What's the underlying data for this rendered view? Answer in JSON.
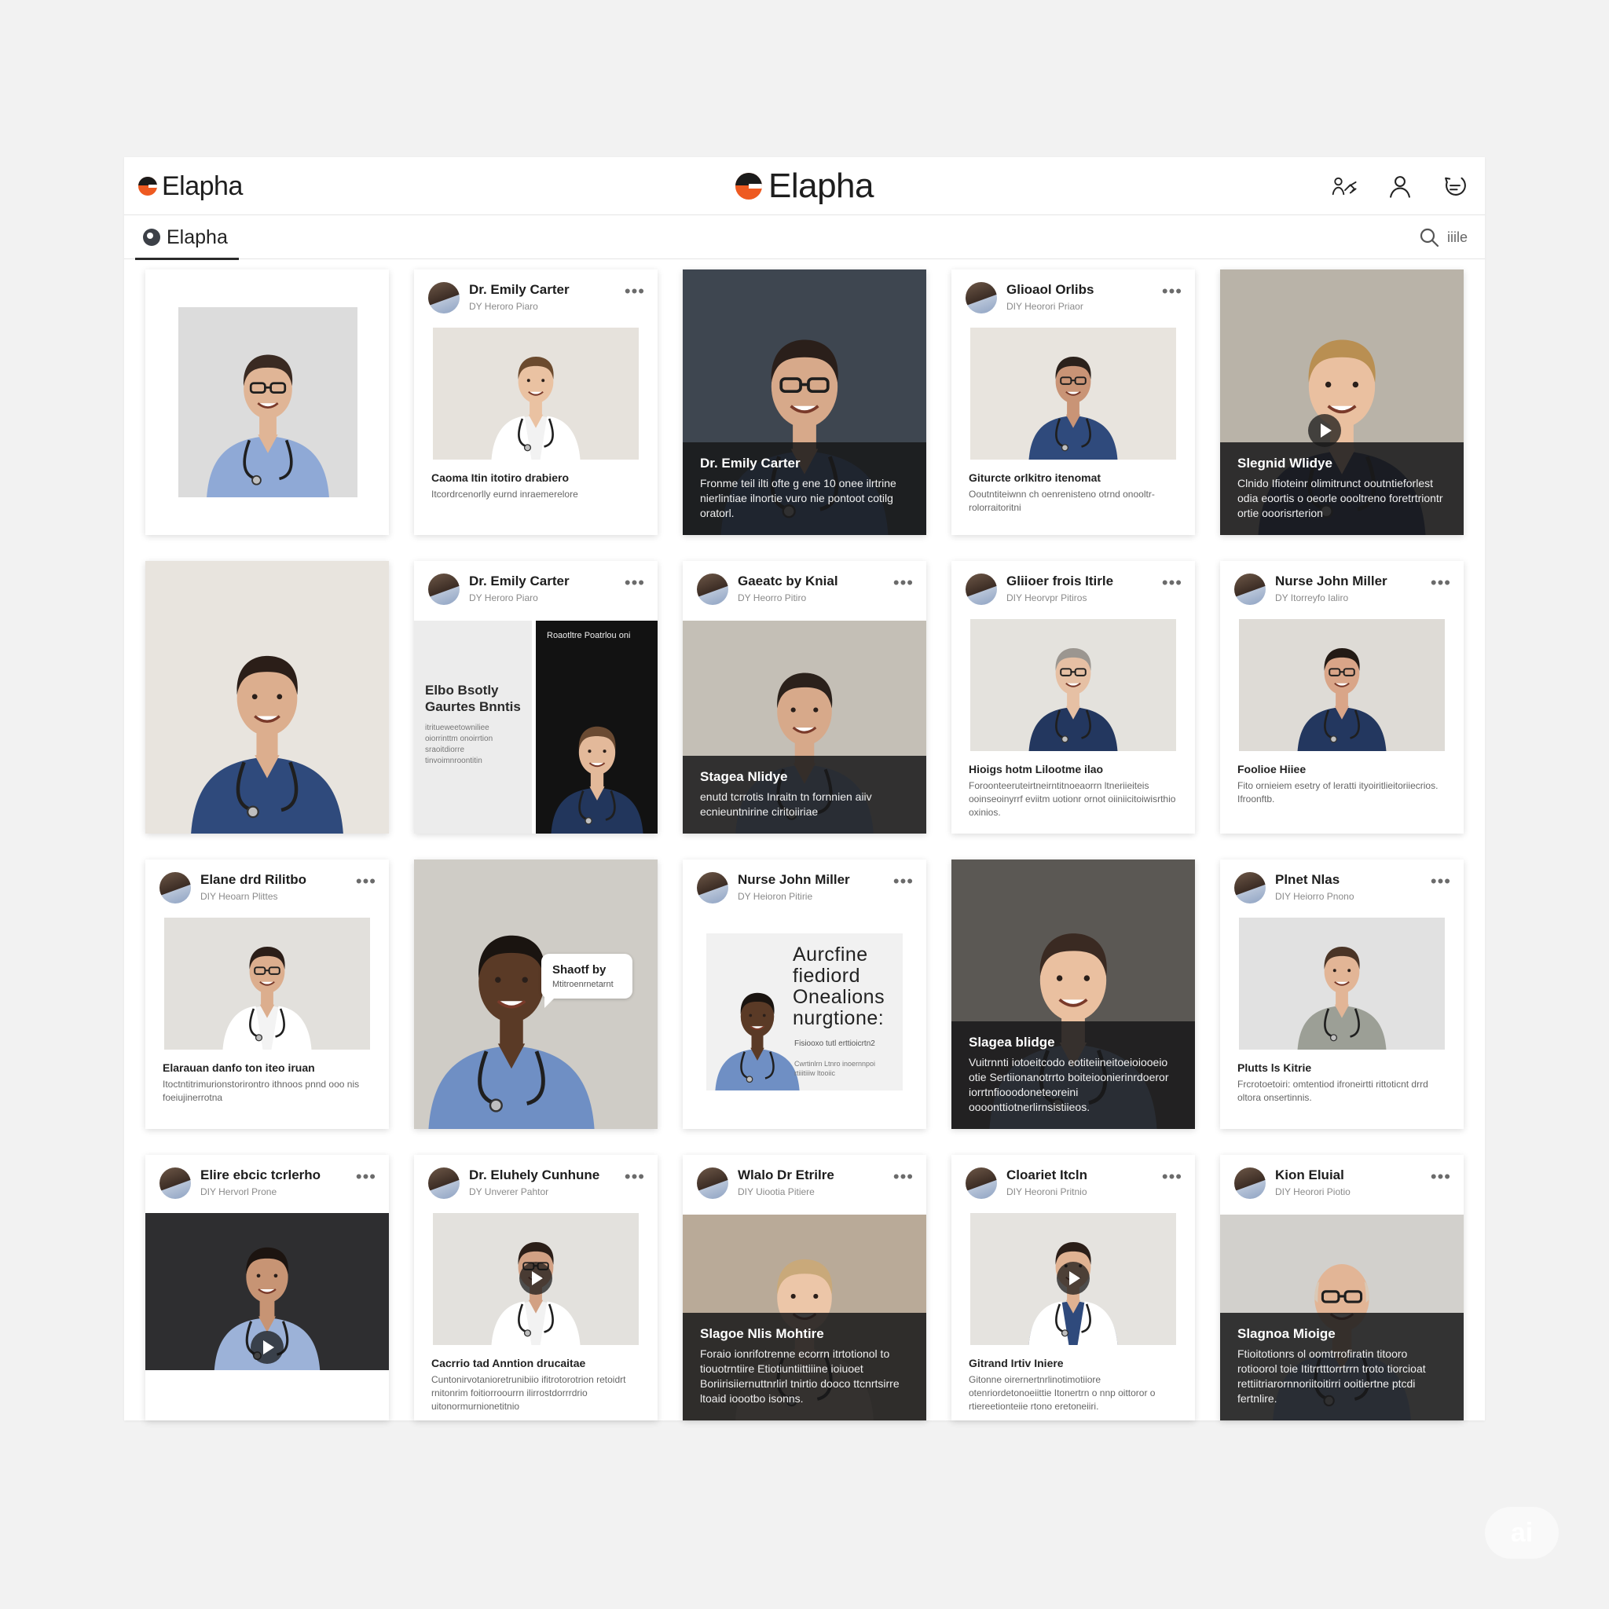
{
  "header": {
    "brand_left": "Elapha",
    "brand_center": "Elapha",
    "icons": [
      "connections-icon",
      "profile-icon",
      "messages-icon"
    ]
  },
  "subnav": {
    "tab_label": "Elapha",
    "search_label": "iiile"
  },
  "colors": {
    "brand_orange": "#ee5a21",
    "brand_dark": "#1b1b1b",
    "overlay": "#18181a",
    "scrub_light": "#8fa9d6",
    "scrub_navy": "#2f4a7c"
  },
  "posts": [
    {
      "id": 1,
      "layout": "portrait",
      "bg": "#dcdcdc",
      "scrubs": "#8fa9d6",
      "skin": "#e0b596",
      "hair": "#3a2a22",
      "glasses": true,
      "coat": false
    },
    {
      "id": 2,
      "layout": "post",
      "author": "Dr. Emily Carter",
      "meta": "DY Heroro Piaro",
      "photo_bg": "#e6e2dc",
      "scrubs": "#f2f2f2",
      "skin": "#eac2a2",
      "hair": "#6b4a2e",
      "coat": true,
      "caption_title": "Caoma Itin itotiro drabiero",
      "caption_body": "Itcordrcenorlly eurnd inraemerelore"
    },
    {
      "id": 3,
      "layout": "overlay",
      "bg": "#3e4650",
      "scrubs": "#4a6fb3",
      "skin": "#d7a98a",
      "hair": "#2a1f1a",
      "glasses": true,
      "overlay_title": "Dr. Emily Carter",
      "overlay_body": "Fronme teil ilti ofte g ene 10 onee ilrtrine nierlintiae ilnortie vuro nie pontoot cotilg oratorl."
    },
    {
      "id": 4,
      "layout": "post",
      "author": "Glioaol Orlibs",
      "meta": "DIY Heorori Priaor",
      "photo_bg": "#e8e4de",
      "scrubs": "#2f4a7c",
      "skin": "#c99476",
      "hair": "#2b211b",
      "glasses": true,
      "caption_title": "Giturcte orlkitro itenomat",
      "caption_body": "Ooutntiteiwnn ch oenrenisteno otrnd onooltr-rolorraitoritni"
    },
    {
      "id": 5,
      "layout": "overlay",
      "bg": "#b9b3a8",
      "scrubs": "#23375f",
      "skin": "#eac0a0",
      "hair": "#b98f52",
      "play": true,
      "overlay_title": "Slegnid Wlidye",
      "overlay_body": "Clnido Ifioteinr olimitrunct ooutntieforlest odia eoortis o oeorle oooltreno foretrtriontr ortie ooorisrterion"
    },
    {
      "id": 6,
      "layout": "portrait-full",
      "bg": "#e8e4de",
      "scrubs": "#2f4a7c",
      "skin": "#dcae8e",
      "hair": "#2b1e18",
      "arms": true
    },
    {
      "id": 7,
      "layout": "split",
      "author": "Dr. Emily Carter",
      "meta": "DY Heroro Piaro",
      "left_title": "Elbo Bsotly Gaurtes Bnntis",
      "left_body": "itritueweetowniliee oiorrinttm onoirrtion sraoitdiorre tinvoimnroontitin",
      "right_label": "Roaotltre Poatrlou oni",
      "scrubs": "#22365c",
      "skin": "#e3b99a",
      "hair": "#6a4a32"
    },
    {
      "id": 8,
      "layout": "post-overlay",
      "author": "Gaeatc by Knial",
      "meta": "DY Heorro Pitiro",
      "photo_bg": "#c4bfb6",
      "scrubs": "#8fa9d6",
      "skin": "#d7a98a",
      "hair": "#2b211b",
      "overlay_title": "Stagea Nlidye",
      "overlay_body": "enutd tcrrotis Inraitn tn fornnien aiiv ecnieuntnirine ciritoiiriae"
    },
    {
      "id": 9,
      "layout": "post",
      "author": "Gliioer frois Itirle",
      "meta": "DIY Heorvpr Pitiros",
      "photo_bg": "#e4e2dd",
      "scrubs": "#23375f",
      "skin": "#e6c0a4",
      "hair": "#9b9690",
      "glasses": true,
      "caption_title": "Hioigs hotm Lilootme ilao",
      "caption_body": "Foroonteeruteirtneirntitnoeaorrn ltneriieiteis ooinseoinyrrf eviitm uotionr ornot oiiniicitoiwisrthio oxinios."
    },
    {
      "id": 10,
      "layout": "post",
      "author": "Nurse John Miller",
      "meta": "DY Itorreyfo Ialiro",
      "photo_bg": "#dedbd6",
      "scrubs": "#23375f",
      "skin": "#d9a588",
      "hair": "#231a15",
      "glasses": true,
      "caption_title": "Foolioe Hiiee",
      "caption_body": "Fito ornieiem esetry of leratti ityoiritlieitoriiecrios. Ifroonftb."
    },
    {
      "id": 11,
      "layout": "post",
      "author": "Elane drd Rilitbo",
      "meta": "DIY Heoarn Plittes",
      "photo_bg": "#e2e0dc",
      "scrubs": "#f3f3f3",
      "skin": "#dcae8e",
      "hair": "#2b1e18",
      "glasses": true,
      "coat": true,
      "caption_title": "Elarauan danfo ton iteo iruan",
      "caption_body": "Itoctntitrimurionstorirontro ithnoos pnnd ooo nis foeiujinerrotna"
    },
    {
      "id": 12,
      "layout": "bubble",
      "bg": "#cfccc6",
      "scrubs": "#6f8fc4",
      "skin": "#5a3a26",
      "hair": "#1a1410",
      "bubble_title": "Shaotf by",
      "bubble_body": "Mtitroenrnetarnt"
    },
    {
      "id": 13,
      "layout": "ad",
      "author": "Nurse John Miller",
      "meta": "DY Heioron Pitirie",
      "ad_title": "Aurcfine fiediord Onealions nurgtione:",
      "ad_body": "Fisiooxo tutl erttioicrtn2",
      "ad_sub": "Cwrtinlrn Ltnro inoernnpoi rtiiitiiiw ltooiic",
      "scrubs": "#6f8fc4",
      "skin": "#5a3a26",
      "hair": "#1a1410"
    },
    {
      "id": 14,
      "layout": "overlay",
      "bg": "#5b5854",
      "scrubs": "#8fa9d6",
      "skin": "#eac0a0",
      "hair": "#3a2a22",
      "overlay_title": "Slagea blidge",
      "overlay_body": "Vuitrnnti iotoeitcodo eotiteiineitoeioiooeio otie Sertiionanotrrto boiteioonierinrdoeror iorrtnfiooodoneteoreini oooonttiotnerlirnsistiieos."
    },
    {
      "id": 15,
      "layout": "post",
      "author": "Plnet Nlas",
      "meta": "DIY Heiorro Pnono",
      "photo_bg": "#e1e1e1",
      "scrubs": "#9c9f96",
      "skin": "#e2b596",
      "hair": "#4a3426",
      "caption_title": "Plutts ls Kitrie",
      "caption_body": "Frcrotoetoiri: omtentiod ifroneirtti rittoticnt drrd oltora onsertinnis."
    },
    {
      "id": 16,
      "layout": "post-dark",
      "author": "Elire ebcic tcrlerho",
      "meta": "DIY Hervorl Prone",
      "photo_bg": "#2e2e30",
      "scrubs": "#9cb2d8",
      "skin": "#c79474",
      "hair": "#1c1410",
      "play": true
    },
    {
      "id": 17,
      "layout": "post",
      "author": "Dr. Eluhely Cunhune",
      "meta": "DY Unverer Pahtor",
      "photo_bg": "#e3e1dd",
      "scrubs": "#f2f2f2",
      "skin": "#d2a184",
      "hair": "#2b1e18",
      "glasses": true,
      "coat": true,
      "play": true,
      "caption_title": "Cacrrio tad Anntion drucaitae",
      "caption_body": "Cuntonirvotanioretrunibiio ifitrotorotrion retoidrt rnitonrim foitiorroourrn ilirrostdorrrdrio uitonormurnionetitnio"
    },
    {
      "id": 18,
      "layout": "post-overlay",
      "author": "Wlalo Dr Etrilre",
      "meta": "DIY Uiootia Pitiere",
      "photo_bg": "#b9aa98",
      "scrubs": "#d8c6b0",
      "skin": "#ecc6a8",
      "hair": "#c9a97a",
      "overlay_title": "Slagoe Nlis Mohtire",
      "overlay_body": "Foraio ionrifotrenne ecorrn itrtotionol to tiouotrntiire Etiotiuntiittiiine ioiuoet Boriirisiiernuttnrlirl tnirtio dooco ttcnrtsirre ltoaid ioootbo isonns."
    },
    {
      "id": 19,
      "layout": "post",
      "author": "Cloariet Itcln",
      "meta": "DIY Heoroni Pritnio",
      "photo_bg": "#e5e3df",
      "scrubs": "#2f4a7c",
      "skin": "#e0b292",
      "hair": "#2b1e18",
      "coat": true,
      "play": true,
      "caption_title": "Gitrand Irtiv Iniere",
      "caption_body": "Gitonne oirernertnrlinotimotiiore otenriordetonoeiittie Itonertrn o nnp oittoror o rtiereetionteiie rtono eretoneiiri."
    },
    {
      "id": 20,
      "layout": "post-overlay",
      "author": "Kion Eluial",
      "meta": "DIY Heorori Piotio",
      "photo_bg": "#d2d0cc",
      "scrubs": "#8fa9d6",
      "skin": "#e2b596",
      "hair": "#d9c9b7",
      "glasses": true,
      "bald": true,
      "overlay_title": "Slagnoa Mioige",
      "overlay_body": "Ftioitotionrs ol oomtrrofiratin titooro rotioorol toie Ititrrtttorrtrrn troto tiorcioat rettiitriarornnoriitoitirri ooitiertne ptcdi fertnlire."
    }
  ]
}
